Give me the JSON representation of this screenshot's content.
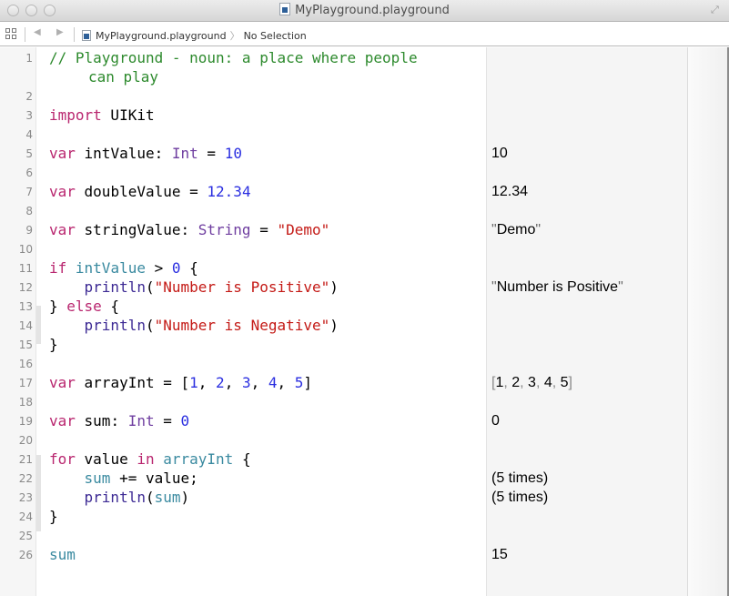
{
  "window": {
    "title": "MyPlayground.playground",
    "title_icon": "playground-file-icon",
    "controls": [
      "close-button",
      "minimize-button",
      "zoom-button"
    ],
    "fullscreen_icon": "fullscreen-arrows-icon"
  },
  "jumpbar": {
    "related_items_icon": "grid-icon",
    "back_icon": "back-triangle-icon",
    "forward_icon": "forward-triangle-icon",
    "breadcrumbs": [
      {
        "label": "MyPlayground.playground",
        "icon": "playground-file-icon"
      },
      {
        "label": "No Selection"
      }
    ],
    "separator": "〉"
  },
  "colors": {
    "keyword": "#b9266f",
    "type": "#6f3ea0",
    "number": "#2a2ee0",
    "string": "#c41a16",
    "comment": "#2d8a2d",
    "function": "#3d2a94",
    "variable": "#3a8aa0"
  },
  "editor": {
    "lines": [
      {
        "n": "1",
        "tokens": [
          {
            "t": "// Playground - noun: a place where people",
            "c": "cm"
          }
        ],
        "cont": [
          {
            "t": "can play",
            "c": "cm"
          }
        ]
      },
      {
        "n": "2",
        "tokens": []
      },
      {
        "n": "3",
        "tokens": [
          {
            "t": "import",
            "c": "kw"
          },
          {
            "t": " UIKit",
            "c": "pl"
          }
        ]
      },
      {
        "n": "4",
        "tokens": []
      },
      {
        "n": "5",
        "tokens": [
          {
            "t": "var",
            "c": "kw"
          },
          {
            "t": " intValue: ",
            "c": "pl"
          },
          {
            "t": "Int",
            "c": "ty"
          },
          {
            "t": " = ",
            "c": "pl"
          },
          {
            "t": "10",
            "c": "num"
          }
        ],
        "result": "10"
      },
      {
        "n": "6",
        "tokens": []
      },
      {
        "n": "7",
        "tokens": [
          {
            "t": "var",
            "c": "kw"
          },
          {
            "t": " doubleValue = ",
            "c": "pl"
          },
          {
            "t": "12.34",
            "c": "num"
          }
        ],
        "result": "12.34"
      },
      {
        "n": "8",
        "tokens": []
      },
      {
        "n": "9",
        "tokens": [
          {
            "t": "var",
            "c": "kw"
          },
          {
            "t": " stringValue: ",
            "c": "pl"
          },
          {
            "t": "String",
            "c": "ty"
          },
          {
            "t": " = ",
            "c": "pl"
          },
          {
            "t": "\"Demo\"",
            "c": "str"
          }
        ],
        "result": "\"Demo\""
      },
      {
        "n": "10",
        "tokens": []
      },
      {
        "n": "11",
        "tokens": [
          {
            "t": "if",
            "c": "kw"
          },
          {
            "t": " ",
            "c": "pl"
          },
          {
            "t": "intValue",
            "c": "vr"
          },
          {
            "t": " > ",
            "c": "pl"
          },
          {
            "t": "0",
            "c": "num"
          },
          {
            "t": " {",
            "c": "pl"
          }
        ]
      },
      {
        "n": "12",
        "tokens": [
          {
            "t": "    ",
            "c": "pl"
          },
          {
            "t": "println",
            "c": "fn"
          },
          {
            "t": "(",
            "c": "pl"
          },
          {
            "t": "\"Number is Positive\"",
            "c": "str"
          },
          {
            "t": ")",
            "c": "pl"
          }
        ],
        "result": "\"Number is Positive\""
      },
      {
        "n": "13",
        "tokens": [
          {
            "t": "} ",
            "c": "pl"
          },
          {
            "t": "else",
            "c": "kw"
          },
          {
            "t": " {",
            "c": "pl"
          }
        ]
      },
      {
        "n": "14",
        "tokens": [
          {
            "t": "    ",
            "c": "pl"
          },
          {
            "t": "println",
            "c": "fn"
          },
          {
            "t": "(",
            "c": "pl"
          },
          {
            "t": "\"Number is Negative\"",
            "c": "str"
          },
          {
            "t": ")",
            "c": "pl"
          }
        ]
      },
      {
        "n": "15",
        "tokens": [
          {
            "t": "}",
            "c": "pl"
          }
        ]
      },
      {
        "n": "16",
        "tokens": []
      },
      {
        "n": "17",
        "tokens": [
          {
            "t": "var",
            "c": "kw"
          },
          {
            "t": " arrayInt = [",
            "c": "pl"
          },
          {
            "t": "1",
            "c": "num"
          },
          {
            "t": ", ",
            "c": "pl"
          },
          {
            "t": "2",
            "c": "num"
          },
          {
            "t": ", ",
            "c": "pl"
          },
          {
            "t": "3",
            "c": "num"
          },
          {
            "t": ", ",
            "c": "pl"
          },
          {
            "t": "4",
            "c": "num"
          },
          {
            "t": ", ",
            "c": "pl"
          },
          {
            "t": "5",
            "c": "num"
          },
          {
            "t": "]",
            "c": "pl"
          }
        ],
        "result": "[1, 2, 3, 4, 5]"
      },
      {
        "n": "18",
        "tokens": []
      },
      {
        "n": "19",
        "tokens": [
          {
            "t": "var",
            "c": "kw"
          },
          {
            "t": " sum: ",
            "c": "pl"
          },
          {
            "t": "Int",
            "c": "ty"
          },
          {
            "t": " = ",
            "c": "pl"
          },
          {
            "t": "0",
            "c": "num"
          }
        ],
        "result": "0"
      },
      {
        "n": "20",
        "tokens": []
      },
      {
        "n": "21",
        "tokens": [
          {
            "t": "for",
            "c": "kw"
          },
          {
            "t": " value ",
            "c": "pl"
          },
          {
            "t": "in",
            "c": "kw"
          },
          {
            "t": " ",
            "c": "pl"
          },
          {
            "t": "arrayInt",
            "c": "vr"
          },
          {
            "t": " {",
            "c": "pl"
          }
        ]
      },
      {
        "n": "22",
        "tokens": [
          {
            "t": "    ",
            "c": "pl"
          },
          {
            "t": "sum",
            "c": "vr"
          },
          {
            "t": " += value;",
            "c": "pl"
          }
        ],
        "result": "(5 times)"
      },
      {
        "n": "23",
        "tokens": [
          {
            "t": "    ",
            "c": "pl"
          },
          {
            "t": "println",
            "c": "fn"
          },
          {
            "t": "(",
            "c": "pl"
          },
          {
            "t": "sum",
            "c": "vr"
          },
          {
            "t": ")",
            "c": "pl"
          }
        ],
        "result": "(5 times)"
      },
      {
        "n": "24",
        "tokens": [
          {
            "t": "}",
            "c": "pl"
          }
        ]
      },
      {
        "n": "25",
        "tokens": []
      },
      {
        "n": "26",
        "tokens": [
          {
            "t": "sum",
            "c": "vr"
          }
        ],
        "result": "15"
      }
    ]
  }
}
